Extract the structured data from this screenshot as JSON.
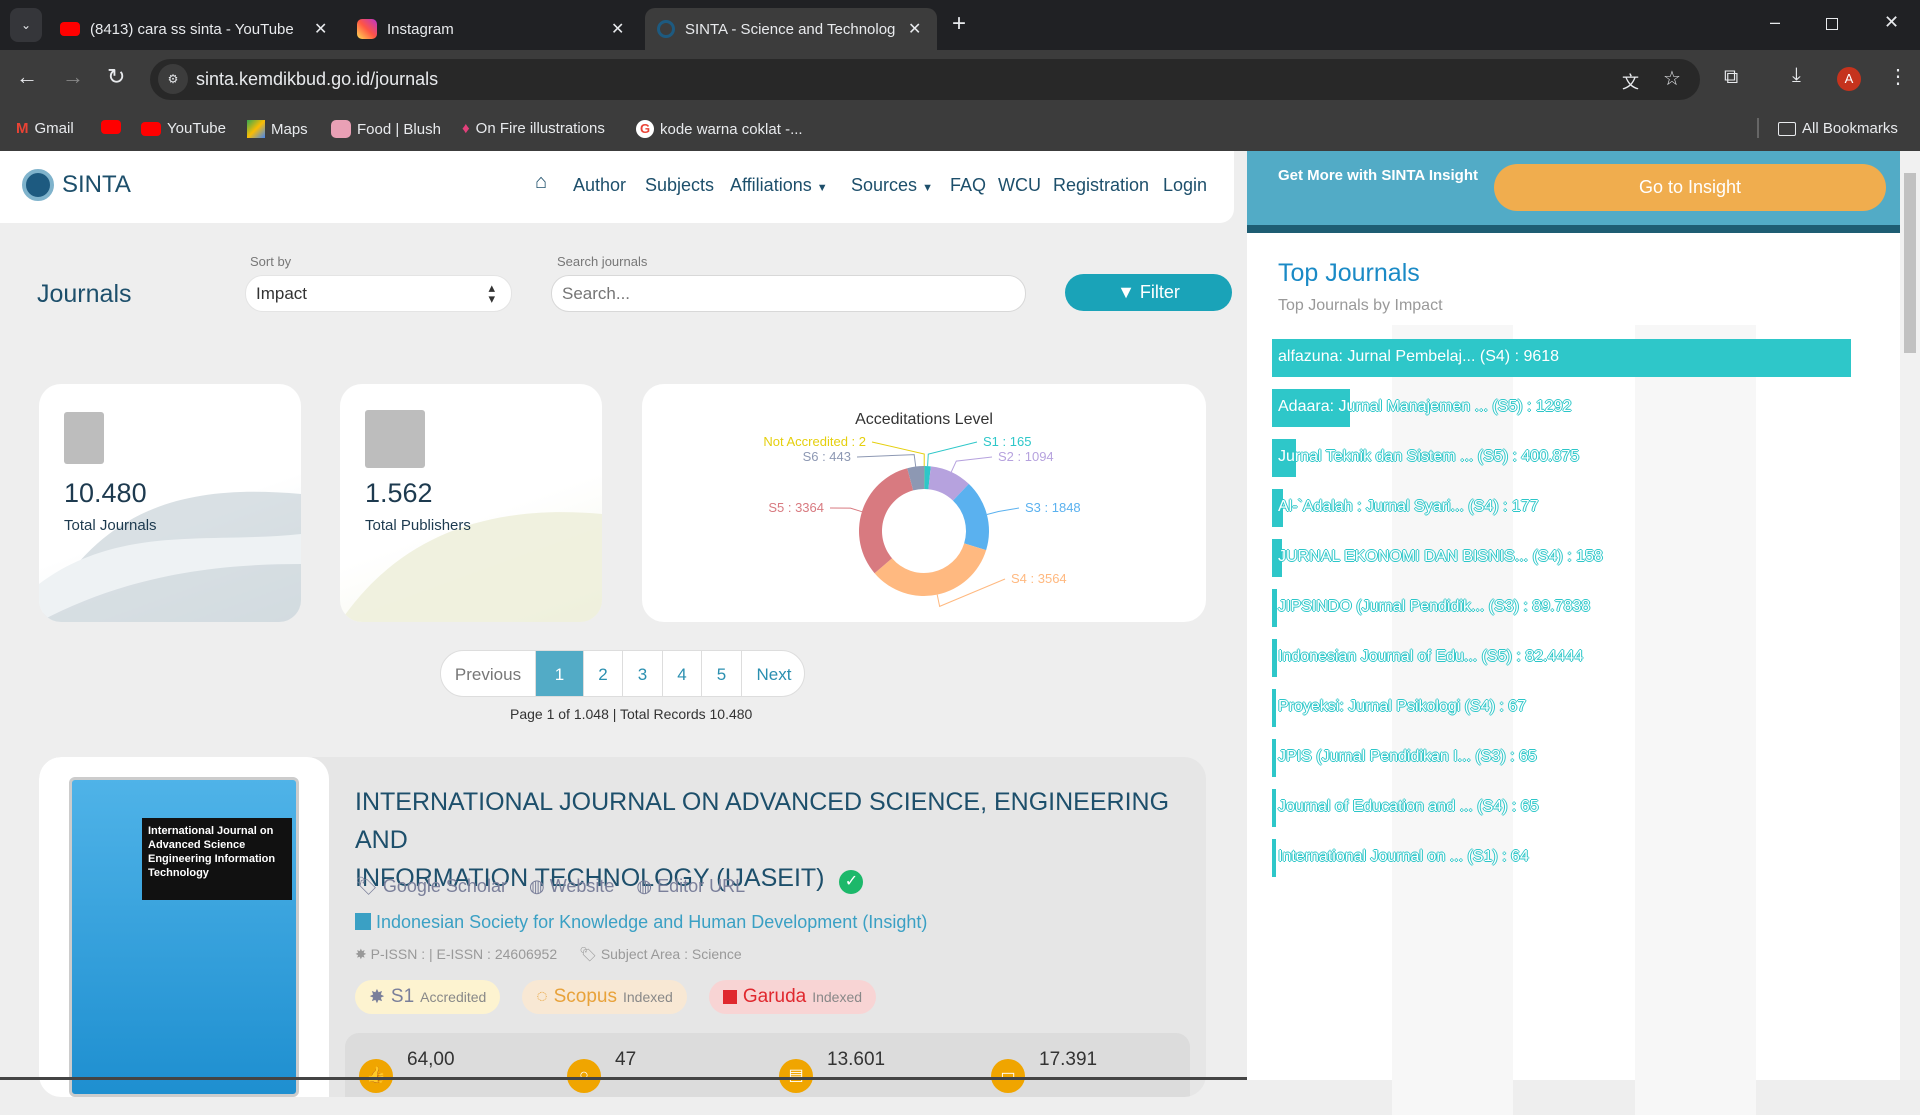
{
  "browser": {
    "tabs": [
      {
        "title": "(8413) cara ss sinta - YouTube",
        "icon": "youtube-icon"
      },
      {
        "title": "Instagram",
        "icon": "instagram-icon"
      },
      {
        "title": "SINTA - Science and Technology",
        "icon": "sinta-icon",
        "active": true
      }
    ],
    "url": "sinta.kemdikbud.go.id/journals",
    "profile_initial": "A",
    "bookmarks": [
      "Gmail",
      "",
      "YouTube",
      "Maps",
      "Food | Blush",
      "On Fire illustrations",
      "kode warna coklat -..."
    ],
    "all_bookmarks": "All Bookmarks"
  },
  "nav": {
    "brand": "SINTA",
    "items": [
      "Author",
      "Subjects",
      "Affiliations",
      "Sources",
      "FAQ",
      "WCU",
      "Registration",
      "Login"
    ]
  },
  "insight": {
    "text": "Get More with SINTA Insight",
    "button": "Go to Insight"
  },
  "page": {
    "title": "Journals",
    "sort_label": "Sort by",
    "sort_value": "Impact",
    "search_label": "Search journals",
    "search_placeholder": "Search...",
    "filter": "Filter"
  },
  "stats": [
    {
      "value": "10.480",
      "label": "Total Journals"
    },
    {
      "value": "1.562",
      "label": "Total Publishers"
    }
  ],
  "chart_data": {
    "type": "pie",
    "title": "Acceditations Level",
    "slices": [
      {
        "name": "Not Accredited",
        "value": 2,
        "color": "#e5cf0d"
      },
      {
        "name": "S1",
        "value": 165,
        "color": "#2ec7c9"
      },
      {
        "name": "S2",
        "value": 1094,
        "color": "#b6a2de"
      },
      {
        "name": "S3",
        "value": 1848,
        "color": "#5ab1ef"
      },
      {
        "name": "S4",
        "value": 3564,
        "color": "#ffb980"
      },
      {
        "name": "S5",
        "value": 3364,
        "color": "#d87a80"
      },
      {
        "name": "S6",
        "value": 443,
        "color": "#8d98b3"
      }
    ]
  },
  "pagination": {
    "prev": "Previous",
    "next": "Next",
    "pages": [
      "1",
      "2",
      "3",
      "4",
      "5"
    ],
    "active": "1",
    "summary": "Page 1 of 1.048 | Total Records 10.480"
  },
  "journal": {
    "cover_text": "International Journal on Advanced Science Engineering Information Technology",
    "title_line1": "INTERNATIONAL JOURNAL ON ADVANCED SCIENCE, ENGINEERING AND",
    "title_line2": "INFORMATION TECHNOLOGY (IJASEIT)",
    "links": [
      "Google Scholar",
      "Website",
      "Editor URL"
    ],
    "publisher": "Indonesian Society for Knowledge and Human Development (Insight)",
    "issn": "P-ISSN : | E-ISSN : 24606952",
    "subject": "Subject Area : Science",
    "badges": [
      {
        "name": "S1",
        "status": "Accredited"
      },
      {
        "name": "Scopus",
        "status": "Indexed"
      },
      {
        "name": "Garuda",
        "status": "Indexed"
      }
    ],
    "metrics": [
      "64,00",
      "47",
      "13.601",
      "17.391"
    ]
  },
  "top_journals": {
    "title": "Top Journals",
    "subtitle": "Top Journals by Impact",
    "chart_data": {
      "type": "bar",
      "items": [
        {
          "label": "alfazuna: Jurnal Pembelaj... (S4) : 9618",
          "value": 9618
        },
        {
          "label": "Adaara: Jurnal Manajemen ... (S5) : 1292",
          "value": 1292
        },
        {
          "label": "Jurnal Teknik dan Sistem ... (S5) : 400.875",
          "value": 400.875
        },
        {
          "label": "Al-`Adalah : Jurnal Syari... (S4) : 177",
          "value": 177
        },
        {
          "label": "JURNAL EKONOMI DAN BISNIS... (S4) : 158",
          "value": 158
        },
        {
          "label": "JIPSINDO (Jurnal Pendidik... (S3) : 89.7838",
          "value": 89.7838
        },
        {
          "label": "Indonesian Journal of Edu... (S5) : 82.4444",
          "value": 82.4444
        },
        {
          "label": "Proyeksi: Jurnal Psikologi (S4) : 67",
          "value": 67
        },
        {
          "label": "JPIS (Jurnal Pendidikan I... (S3) : 65",
          "value": 65
        },
        {
          "label": "Journal of Education and ... (S4) : 65",
          "value": 65
        },
        {
          "label": "International Journal on ... (S1) : 64",
          "value": 64
        }
      ]
    }
  }
}
